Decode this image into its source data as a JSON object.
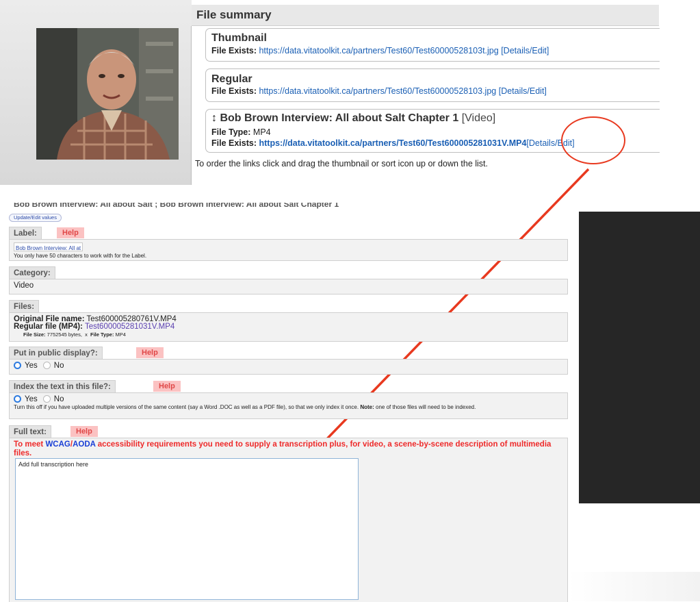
{
  "summary": {
    "title": "File summary",
    "files": [
      {
        "title": "Thumbnail",
        "exists_label": "File Exists:",
        "url": "https://data.vitatoolkit.ca/partners/Test60/Test60000528103t.jpg",
        "action": "[Details/Edit]"
      },
      {
        "title": "Regular",
        "exists_label": "File Exists:",
        "url": "https://data.vitatoolkit.ca/partners/Test60/Test60000528103.jpg",
        "action": "[Details/Edit]"
      }
    ],
    "video": {
      "sort_icon": "↕",
      "title": "Bob Brown Interview: All about Salt Chapter 1",
      "kind": "[Video]",
      "type_label": "File Type:",
      "type_value": "MP4",
      "exists_label": "File Exists:",
      "url": "https://data.vitatoolkit.ca/partners/Test60/Test600005281031V.MP4",
      "action": "[Details/Edit]"
    },
    "note": "To order the links click and drag the thumbnail or sort icon up or down the list."
  },
  "form": {
    "title": "Bob Brown Interview: All about Salt ; Bob Brown Interview: All about Salt Chapter 1",
    "update_button": "Update/Edit values",
    "help": "Help",
    "label": {
      "tab": "Label:",
      "value": "Bob Brown Interview: All at",
      "hint": "You only have 50 characters to work with for the Label."
    },
    "category": {
      "tab": "Category:",
      "value": "Video"
    },
    "files": {
      "tab": "Files:",
      "original_label": "Original File name:",
      "original_value": "Test600005280761V.MP4",
      "regular_label": "Regular file (MP4):",
      "regular_value": "Test600005281031V.MP4",
      "size_label": "File Size:",
      "size_value": "7752545 bytes,",
      "separator": "x",
      "type_label": "File Type:",
      "type_value": "MP4"
    },
    "public": {
      "tab": "Put in public display?:",
      "yes": "Yes",
      "no": "No"
    },
    "index": {
      "tab": "Index the text in this file?:",
      "yes": "Yes",
      "no": "No",
      "hint_a": "Turn this off if you have uploaded multiple versions of the same content (say a Word .DOC as well as a PDF file), so that we only index it once.",
      "hint_note": "Note:",
      "hint_b": "one of those files will need to be indexed."
    },
    "fulltext": {
      "tab": "Full text:",
      "warning_a": "To meet",
      "warning_wcag": "WCAG",
      "warning_slash": "/",
      "warning_aoda": "AODA",
      "warning_b": "accessibility requirements you need to supply a transcription plus, for video, a scene-by-scene description of multimedia files.",
      "value": "Add full transcription here"
    }
  },
  "colors": {
    "annotation": "#e8391f",
    "link": "#1a5fb4",
    "help_bg": "#fbc2c2",
    "warning": "#ee2a2a"
  }
}
